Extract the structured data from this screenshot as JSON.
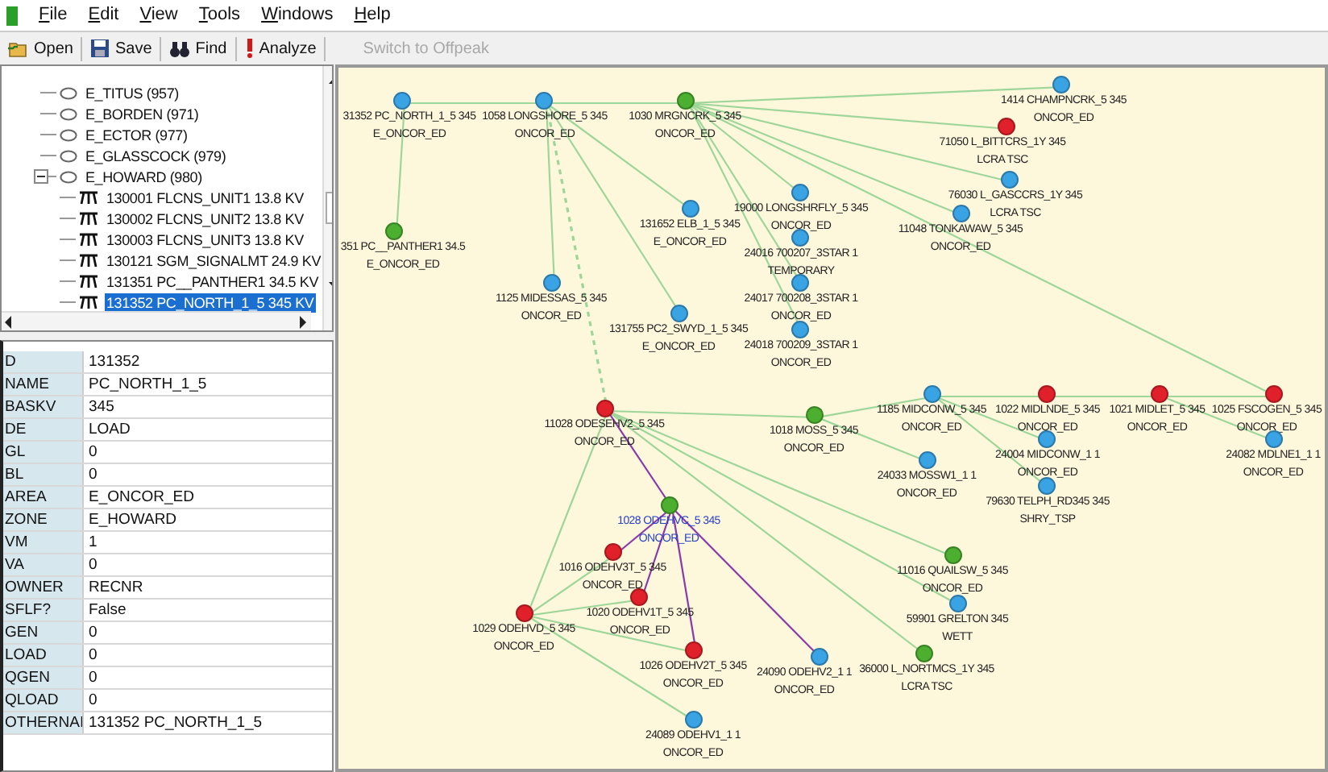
{
  "menu": [
    "File",
    "Edit",
    "View",
    "Tools",
    "Windows",
    "Help"
  ],
  "toolbar": [
    {
      "label": "Open",
      "kind": "open",
      "disabled": false
    },
    {
      "label": "Save",
      "kind": "save",
      "disabled": false
    },
    {
      "label": "Find",
      "kind": "find",
      "disabled": false
    },
    {
      "label": "Analyze",
      "kind": "analyze",
      "disabled": false
    },
    {
      "label": "Switch to Offpeak",
      "kind": "text",
      "disabled": true
    }
  ],
  "tree": [
    {
      "label": "E_TITUS (957)",
      "selected": false
    },
    {
      "label": "E_BORDEN (971)",
      "selected": false
    },
    {
      "label": "E_ECTOR (977)",
      "selected": false
    },
    {
      "label": "E_GLASSCOCK (979)",
      "selected": false
    },
    {
      "label": "E_HOWARD (980)",
      "expanded": true,
      "selected": false,
      "children": [
        {
          "label": "130001 FLCNS_UNIT1  13.8 KV",
          "selected": false
        },
        {
          "label": "130002 FLCNS_UNIT2  13.8 KV",
          "selected": false
        },
        {
          "label": "130003 FLCNS_UNIT3  13.8 KV",
          "selected": false
        },
        {
          "label": "130121 SGM_SIGNALMT 24.9 KV",
          "selected": false
        },
        {
          "label": "131351 PC__PANTHER1 34.5 KV",
          "selected": false
        },
        {
          "label": "131352 PC_NORTH_1_5 345 KV",
          "selected": true
        }
      ]
    }
  ],
  "properties": [
    {
      "name": "D",
      "value": "131352"
    },
    {
      "name": "NAME",
      "value": "PC_NORTH_1_5"
    },
    {
      "name": "BASKV",
      "value": "345"
    },
    {
      "name": "DE",
      "value": "LOAD"
    },
    {
      "name": "GL",
      "value": "0"
    },
    {
      "name": "BL",
      "value": "0"
    },
    {
      "name": "AREA",
      "value": "E_ONCOR_ED"
    },
    {
      "name": "ZONE",
      "value": "E_HOWARD"
    },
    {
      "name": "VM",
      "value": "1"
    },
    {
      "name": "VA",
      "value": "0"
    },
    {
      "name": "OWNER",
      "value": "RECNR"
    },
    {
      "name": "SFLF?",
      "value": "False"
    },
    {
      "name": "GEN",
      "value": "0"
    },
    {
      "name": "LOAD",
      "value": "0"
    },
    {
      "name": "QGEN",
      "value": "0"
    },
    {
      "name": "QLOAD",
      "value": "0"
    },
    {
      "name": "OTHERNAI",
      "value": "131352 PC_NORTH_1_5"
    }
  ],
  "diagram": {
    "nodes": [
      {
        "name": "31352 PC_NORTH_1_5 345",
        "area": "E_ONCOR_ED",
        "color": "#3aa3e3",
        "selected": false
      },
      {
        "name": "1058 LONGSHORE_5 345",
        "area": "ONCOR_ED",
        "color": "#3aa3e3",
        "selected": false
      },
      {
        "name": "1030 MRGNCRK_5 345",
        "area": "ONCOR_ED",
        "color": "#4caf30",
        "selected": false
      },
      {
        "name": "1414 CHAMPNCRK_5 345",
        "area": "ONCOR_ED",
        "color": "#3aa3e3",
        "selected": false
      },
      {
        "name": "71050 L_BITTCRS_1Y 345",
        "area": "LCRA TSC",
        "color": "#e0202a",
        "selected": false
      },
      {
        "name": "76030 L_GASCCRS_1Y 345",
        "area": "LCRA TSC",
        "color": "#3aa3e3",
        "selected": false
      },
      {
        "name": "11048 TONKAWAW_5 345",
        "area": "ONCOR_ED",
        "color": "#3aa3e3",
        "selected": false
      },
      {
        "name": "19000 LONGSHRFLY_5 345",
        "area": "ONCOR_ED",
        "color": "#3aa3e3",
        "selected": false
      },
      {
        "name": "131652 ELB_1_5 345",
        "area": "E_ONCOR_ED",
        "color": "#3aa3e3",
        "selected": false
      },
      {
        "name": "24016 700207_3STAR 1",
        "area": "TEMPORARY",
        "color": "#3aa3e3",
        "selected": false
      },
      {
        "name": "24017 700208_3STAR 1",
        "area": "ONCOR_ED",
        "color": "#3aa3e3",
        "selected": false
      },
      {
        "name": "24018 700209_3STAR 1",
        "area": "ONCOR_ED",
        "color": "#3aa3e3",
        "selected": false
      },
      {
        "name": "351 PC__PANTHER1 34.5",
        "area": "E_ONCOR_ED",
        "color": "#4caf30",
        "selected": false
      },
      {
        "name": "1125 MIDESSAS_5 345",
        "area": "ONCOR_ED",
        "color": "#3aa3e3",
        "selected": false
      },
      {
        "name": "131755 PC2_SWYD_1_5 345",
        "area": "E_ONCOR_ED",
        "color": "#3aa3e3",
        "selected": false
      },
      {
        "name": "11028 ODESEHV2_5 345",
        "area": "ONCOR_ED",
        "color": "#e0202a",
        "selected": false
      },
      {
        "name": "1018 MOSS_5 345",
        "area": "ONCOR_ED",
        "color": "#4caf30",
        "selected": false
      },
      {
        "name": "1185 MIDCONW_5 345",
        "area": "ONCOR_ED",
        "color": "#3aa3e3",
        "selected": false
      },
      {
        "name": "1022 MIDLNDE_5 345",
        "area": "ONCOR_ED",
        "color": "#e0202a",
        "selected": false
      },
      {
        "name": "1021 MIDLET_5 345",
        "area": "ONCOR_ED",
        "color": "#e0202a",
        "selected": false
      },
      {
        "name": "1025 FSCOGEN_5 345",
        "area": "ONCOR_ED",
        "color": "#e0202a",
        "selected": false
      },
      {
        "name": "24004 MIDCONW_1 1",
        "area": "ONCOR_ED",
        "color": "#3aa3e3",
        "selected": false
      },
      {
        "name": "24033 MOSSW1_1 1",
        "area": "ONCOR_ED",
        "color": "#3aa3e3",
        "selected": false
      },
      {
        "name": "24082 MDLNE1_1 1",
        "area": "ONCOR_ED",
        "color": "#3aa3e3",
        "selected": false
      },
      {
        "name": "79630 TELPH_RD345 345",
        "area": "SHRY_TSP",
        "color": "#3aa3e3",
        "selected": false
      },
      {
        "name": "1028 ODEHVC_5 345",
        "area": "ONCOR_ED",
        "color": "#4caf30",
        "selected": true
      },
      {
        "name": "1016 ODEHV3T_5 345",
        "area": "ONCOR_ED",
        "color": "#e0202a",
        "selected": false
      },
      {
        "name": "11016 QUAILSW_5 345",
        "area": "ONCOR_ED",
        "color": "#4caf30",
        "selected": false
      },
      {
        "name": "1029 ODEHVD_5 345",
        "area": "ONCOR_ED",
        "color": "#e0202a",
        "selected": false
      },
      {
        "name": "1020 ODEHV1T_5 345",
        "area": "ONCOR_ED",
        "color": "#e0202a",
        "selected": false
      },
      {
        "name": "59901 GRELTON 345",
        "area": "WETT",
        "color": "#3aa3e3",
        "selected": false
      },
      {
        "name": "1026 ODEHV2T_5 345",
        "area": "ONCOR_ED",
        "color": "#e0202a",
        "selected": false
      },
      {
        "name": "24090 ODEHV2_1 1",
        "area": "ONCOR_ED",
        "color": "#3aa3e3",
        "selected": false
      },
      {
        "name": "36000 L_NORTMCS_1Y 345",
        "area": "LCRA TSC",
        "color": "#4caf30",
        "selected": false
      },
      {
        "name": "24089 ODEHV1_1 1",
        "area": "ONCOR_ED",
        "color": "#3aa3e3",
        "selected": false
      }
    ]
  }
}
